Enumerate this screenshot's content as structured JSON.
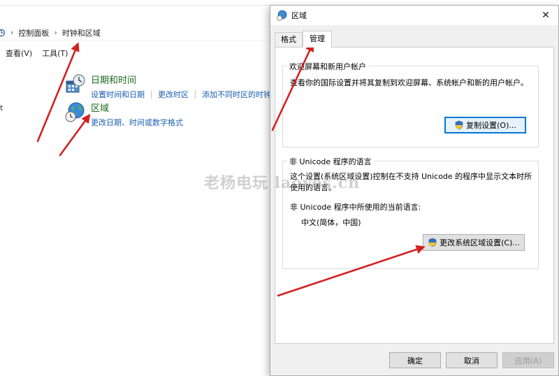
{
  "control_panel": {
    "breadcrumb": [
      "控制面板",
      "时钟和区域"
    ],
    "menu": [
      "查看(V)",
      "工具(T)"
    ],
    "left_edge_text": "t",
    "categories": [
      {
        "title": "日期和时间",
        "icon": "clock-calendar-icon",
        "links": [
          "设置时间和日期",
          "更改时区",
          "添加不同时区的时钟"
        ]
      },
      {
        "title": "区域",
        "icon": "globe-clock-icon",
        "links": [
          "更改日期、时间或数字格式"
        ]
      }
    ]
  },
  "dialog": {
    "title": "区域",
    "close_glyph": "✕",
    "tabs": [
      "格式",
      "管理"
    ],
    "active_tab": "管理",
    "welcome_group": {
      "legend": "欢迎屏幕和新用户帐户",
      "description": "查看你的国际设置并将其复制到欢迎屏幕、系统帐户和新的用户帐户。",
      "button": "复制设置(O)..."
    },
    "unicode_group": {
      "legend": "非 Unicode 程序的语言",
      "description": "这个设置(系统区域设置)控制在不支持 Unicode 的程序中显示文本时所使用的语言。",
      "current_label": "非 Unicode 程序中所使用的当前语言:",
      "current_value": "中文(简体，中国)",
      "button": "更改系统区域设置(C)..."
    },
    "footer": {
      "ok": "确定",
      "cancel": "取消",
      "apply": "应用(A)"
    }
  },
  "watermark": "老杨电玩 laoyes.cn",
  "colors": {
    "annotation_arrow": "#d42020",
    "link": "#1a5fb4",
    "category_title": "#1b6a1b",
    "focus_border": "#0078d7"
  }
}
